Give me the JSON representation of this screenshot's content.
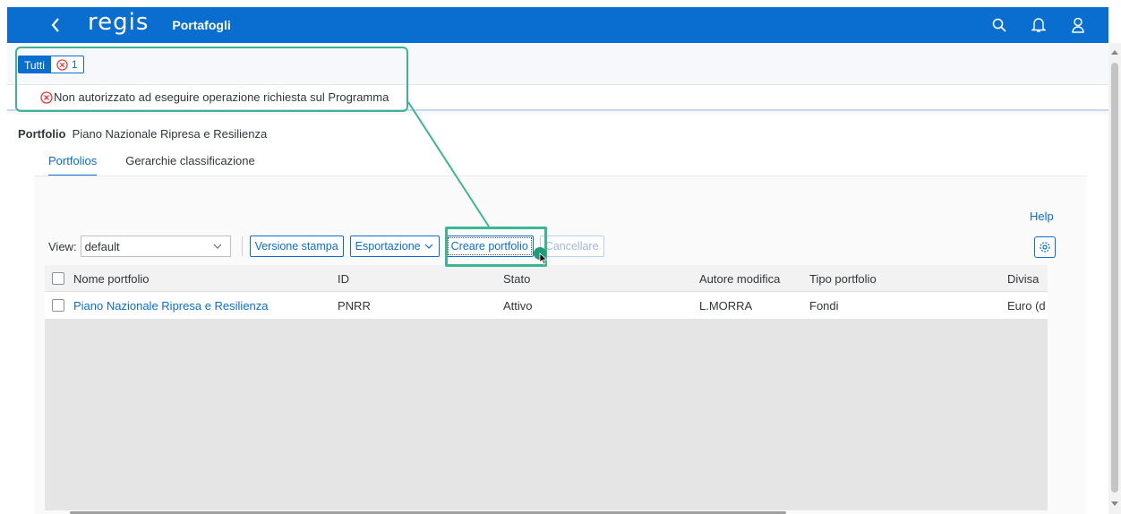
{
  "header": {
    "logo": "regis",
    "title": "Portafogli"
  },
  "messages": {
    "filter_all": "Tutti",
    "error_count": "1",
    "error_text": "Non autorizzato ad eseguire operazione richiesta sul Programma"
  },
  "object": {
    "label": "Portfolio",
    "value": "Piano Nazionale Ripresa e Resilienza"
  },
  "tabs": [
    {
      "label": "Portfolios",
      "active": true
    },
    {
      "label": "Gerarchie classificazione",
      "active": false
    }
  ],
  "help": "Help",
  "toolbar": {
    "view_label": "View:",
    "view_value": "default",
    "print_label": "Versione stampa",
    "export_label": "Esportazione",
    "create_label": "Creare portfolio",
    "delete_label": "Cancellare"
  },
  "table": {
    "columns": [
      "Nome portfolio",
      "ID",
      "Stato",
      "Autore modifica",
      "Tipo portfolio",
      "Divisa"
    ],
    "rows": [
      {
        "name": "Piano Nazionale Ripresa e Resilienza",
        "id": "PNRR",
        "status": "Attivo",
        "author": "L.MORRA",
        "type": "Fondi",
        "currency": "Euro (d"
      }
    ]
  },
  "colors": {
    "shell": "#0a6ed1",
    "highlight": "#3cb591",
    "error": "#e53935"
  }
}
